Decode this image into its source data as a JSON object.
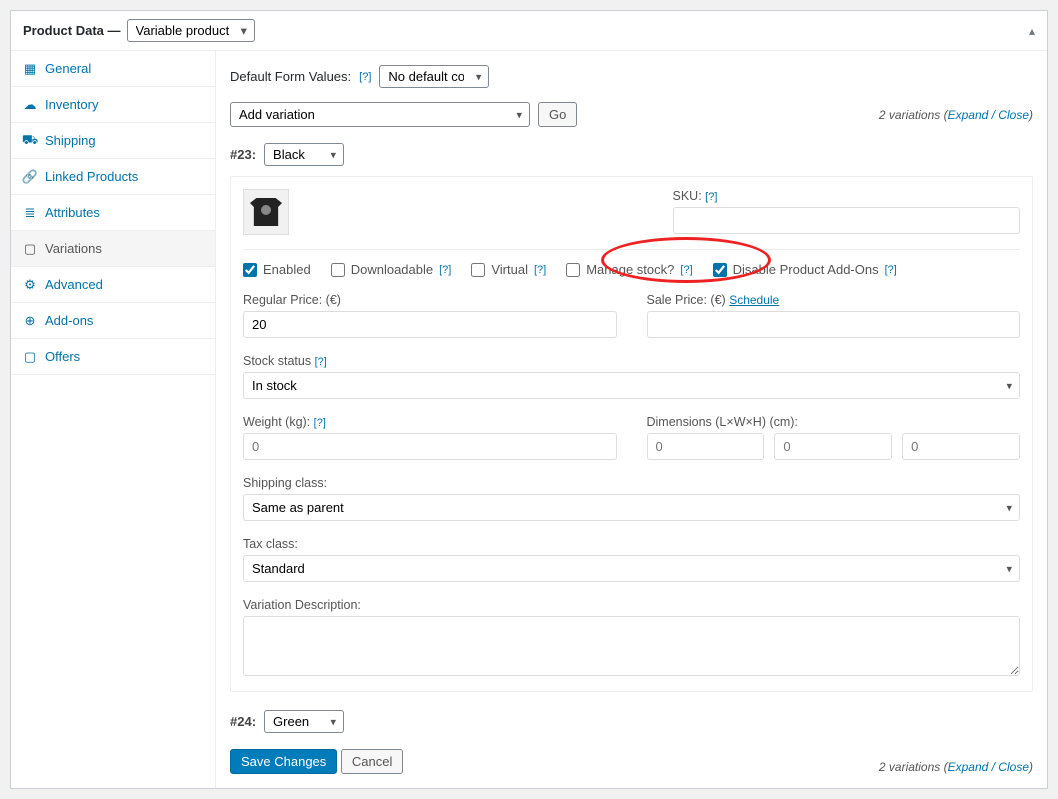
{
  "header": {
    "title": "Product Data —",
    "type_select": "Variable product"
  },
  "sidebar": {
    "items": [
      {
        "label": "General"
      },
      {
        "label": "Inventory"
      },
      {
        "label": "Shipping"
      },
      {
        "label": "Linked Products"
      },
      {
        "label": "Attributes"
      },
      {
        "label": "Variations"
      },
      {
        "label": "Advanced"
      },
      {
        "label": "Add-ons"
      },
      {
        "label": "Offers"
      }
    ]
  },
  "content": {
    "default_form_label": "Default Form Values:",
    "default_form_select": "No default color…",
    "add_variation_select": "Add variation",
    "go_btn": "Go",
    "variations_count_text": "2 variations",
    "expand_close": "Expand / Close",
    "variation_a": {
      "id_label": "#23:",
      "attr_value": "Black",
      "sku_label": "SKU:",
      "sku_value": "",
      "checks": {
        "enabled": "Enabled",
        "downloadable": "Downloadable",
        "virtual": "Virtual",
        "manage_stock": "Manage stock?",
        "disable_addons": "Disable Product Add-Ons"
      },
      "regular_price_label": "Regular Price: (€)",
      "regular_price_value": "20",
      "sale_price_label": "Sale Price: (€)",
      "schedule_link": "Schedule",
      "stock_status_label": "Stock status",
      "stock_status_value": "In stock",
      "weight_label": "Weight (kg):",
      "weight_placeholder": "0",
      "dimensions_label": "Dimensions (L×W×H) (cm):",
      "dim_placeholder": "0",
      "shipping_class_label": "Shipping class:",
      "shipping_class_value": "Same as parent",
      "tax_class_label": "Tax class:",
      "tax_class_value": "Standard",
      "description_label": "Variation Description:"
    },
    "variation_b": {
      "id_label": "#24:",
      "attr_value": "Green"
    },
    "save_btn": "Save Changes",
    "cancel_btn": "Cancel"
  },
  "help": "[?]"
}
